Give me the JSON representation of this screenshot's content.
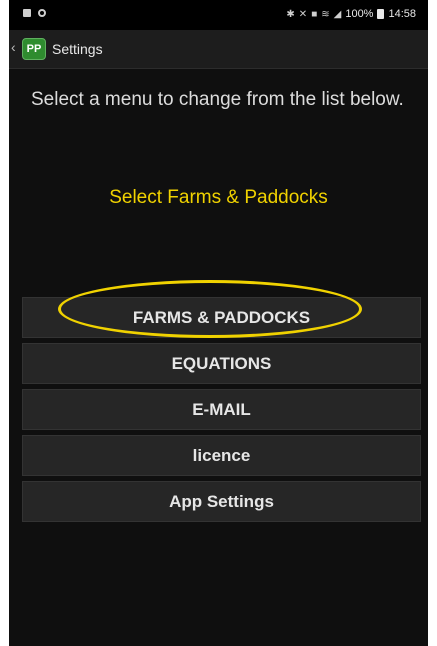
{
  "status_bar": {
    "battery": "100%",
    "time": "14:58",
    "icons": [
      "notification-square-icon",
      "notification-circle-icon",
      "bluetooth-icon",
      "mute-icon",
      "alarm-icon",
      "wifi-icon",
      "signal-icon",
      "battery-icon"
    ]
  },
  "app_bar": {
    "logo_text": "PP",
    "title": "Settings"
  },
  "main": {
    "instruction": "Select a menu to change from the list below.",
    "annotation": "Select Farms & Paddocks",
    "annotation_color": "#f0d200"
  },
  "menu": {
    "items": [
      {
        "label": "FARMS & PADDOCKS"
      },
      {
        "label": "EQUATIONS"
      },
      {
        "label": "E-MAIL"
      },
      {
        "label": "licence"
      },
      {
        "label": "App Settings"
      }
    ]
  }
}
